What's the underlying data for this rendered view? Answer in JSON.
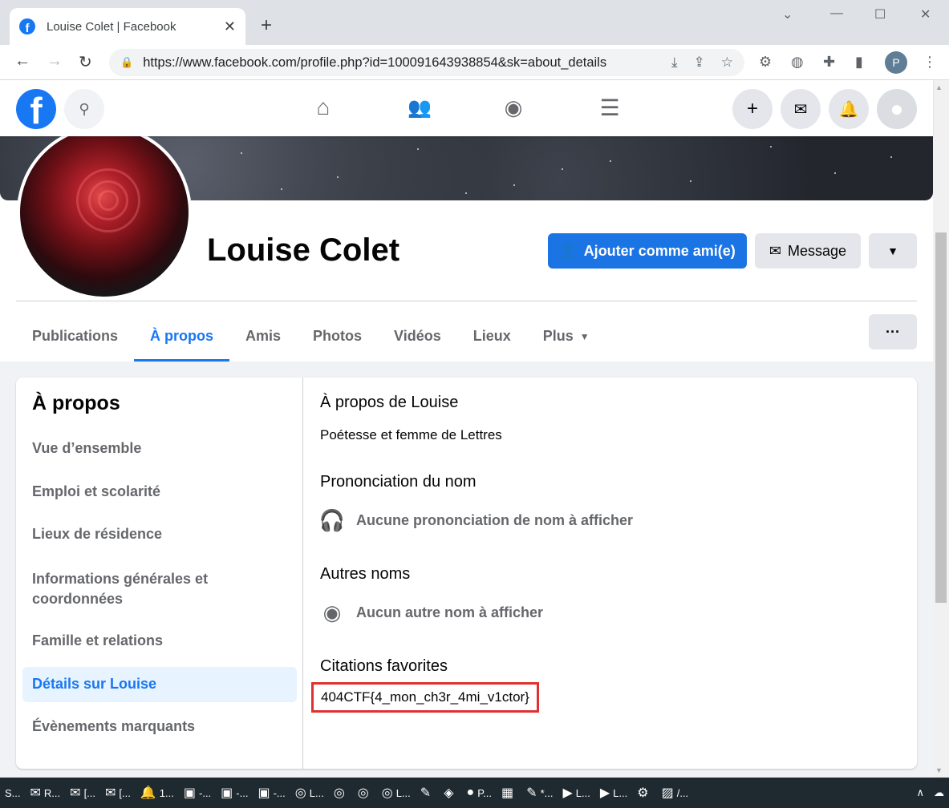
{
  "browser": {
    "tab_title": "Louise Colet | Facebook",
    "url": "https://www.facebook.com/profile.php?id=100091643938854&sk=about_details",
    "profile_initial": "P"
  },
  "fb_nav": {
    "logo": "f"
  },
  "profile": {
    "name": "Louise Colet",
    "add_friend_label": "Ajouter comme ami(e)",
    "message_label": "Message",
    "tabs": [
      "Publications",
      "À propos",
      "Amis",
      "Photos",
      "Vidéos",
      "Lieux",
      "Plus"
    ],
    "active_tab": "À propos",
    "more_dots": "···"
  },
  "about": {
    "heading": "À propos",
    "side_items": [
      "Vue d’ensemble",
      "Emploi et scolarité",
      "Lieux de résidence",
      "Informations générales et coordonnées",
      "Famille et relations",
      "Détails sur Louise",
      "Évènements marquants"
    ],
    "active_item": "Détails sur Louise",
    "sections": {
      "about_title": "À propos de Louise",
      "about_text": "Poétesse et femme de Lettres",
      "pronunciation_title": "Prononciation du nom",
      "pronunciation_text": "Aucune prononciation de nom à afficher",
      "other_names_title": "Autres noms",
      "other_names_text": "Aucun autre nom à afficher",
      "quotes_title": "Citations favorites",
      "quotes_text": "404CTF{4_mon_ch3r_4mi_v1ctor}"
    }
  },
  "taskbar": {
    "items": [
      "S...",
      "R...",
      "[...",
      "[...",
      "1...",
      "-...",
      "-...",
      "-...",
      "L...",
      "",
      "",
      "L...",
      "",
      "",
      "P...",
      "",
      "*...",
      "L...",
      "L...",
      "",
      "/..."
    ]
  },
  "colors": {
    "fb_blue": "#1877f2",
    "highlight_red": "#e03131"
  }
}
